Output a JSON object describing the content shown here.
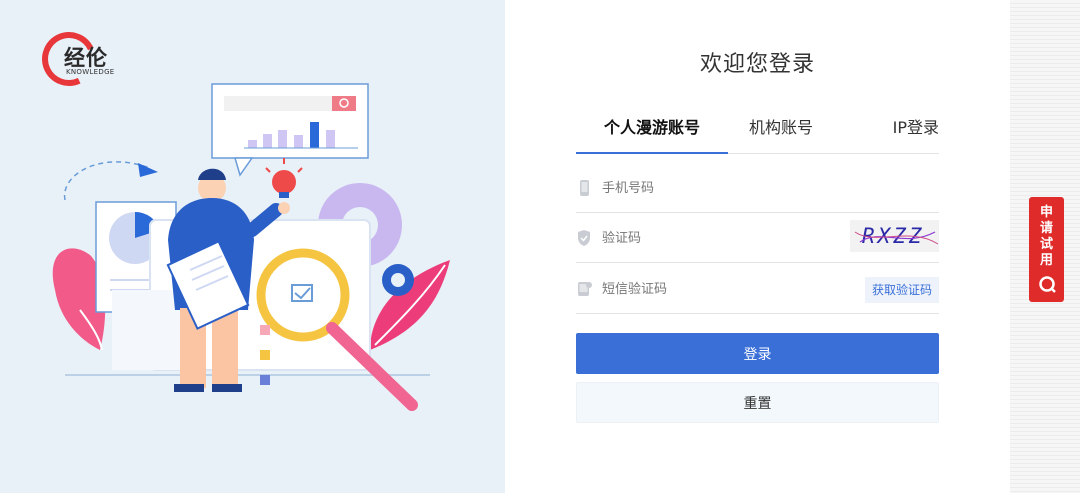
{
  "logo": {
    "cn": "经伦",
    "en": "KNOWLEDGE"
  },
  "login": {
    "title": "欢迎您登录",
    "tabs": [
      {
        "label": "个人漫游账号",
        "active": true
      },
      {
        "label": "机构账号",
        "active": false
      },
      {
        "label": "IP登录",
        "active": false
      }
    ],
    "phone_placeholder": "手机号码",
    "captcha_placeholder": "验证码",
    "captcha_text": "RXZZ",
    "sms_placeholder": "短信验证码",
    "sms_button": "获取验证码",
    "login_button": "登录",
    "reset_button": "重置"
  },
  "side": {
    "trial_label": "申请试用"
  },
  "colors": {
    "primary": "#3a6fd8",
    "trial_red": "#e02b2b",
    "panel_bg": "#e8f0f8"
  }
}
